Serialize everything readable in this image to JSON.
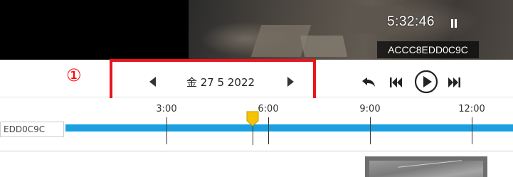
{
  "player": {
    "time": "5:32:46",
    "camera_id": "ACCC8EDD0C9C",
    "state_icon": "pause-icon"
  },
  "annotation": {
    "marker": "①",
    "color": "#e8141e"
  },
  "toolbar": {
    "date": "金 27 5 2022",
    "prev_icon": "triangle-left-icon",
    "next_icon": "triangle-right-icon",
    "controls": [
      "undo-icon",
      "skip-back-icon",
      "play-icon",
      "skip-forward-icon"
    ]
  },
  "timeline": {
    "track_label": "EDD0C9C",
    "time_labels": [
      "3:00",
      "6:00",
      "9:00",
      "12:00"
    ],
    "track_color": "#1aa0e0",
    "marker_color": "#f5c400"
  }
}
